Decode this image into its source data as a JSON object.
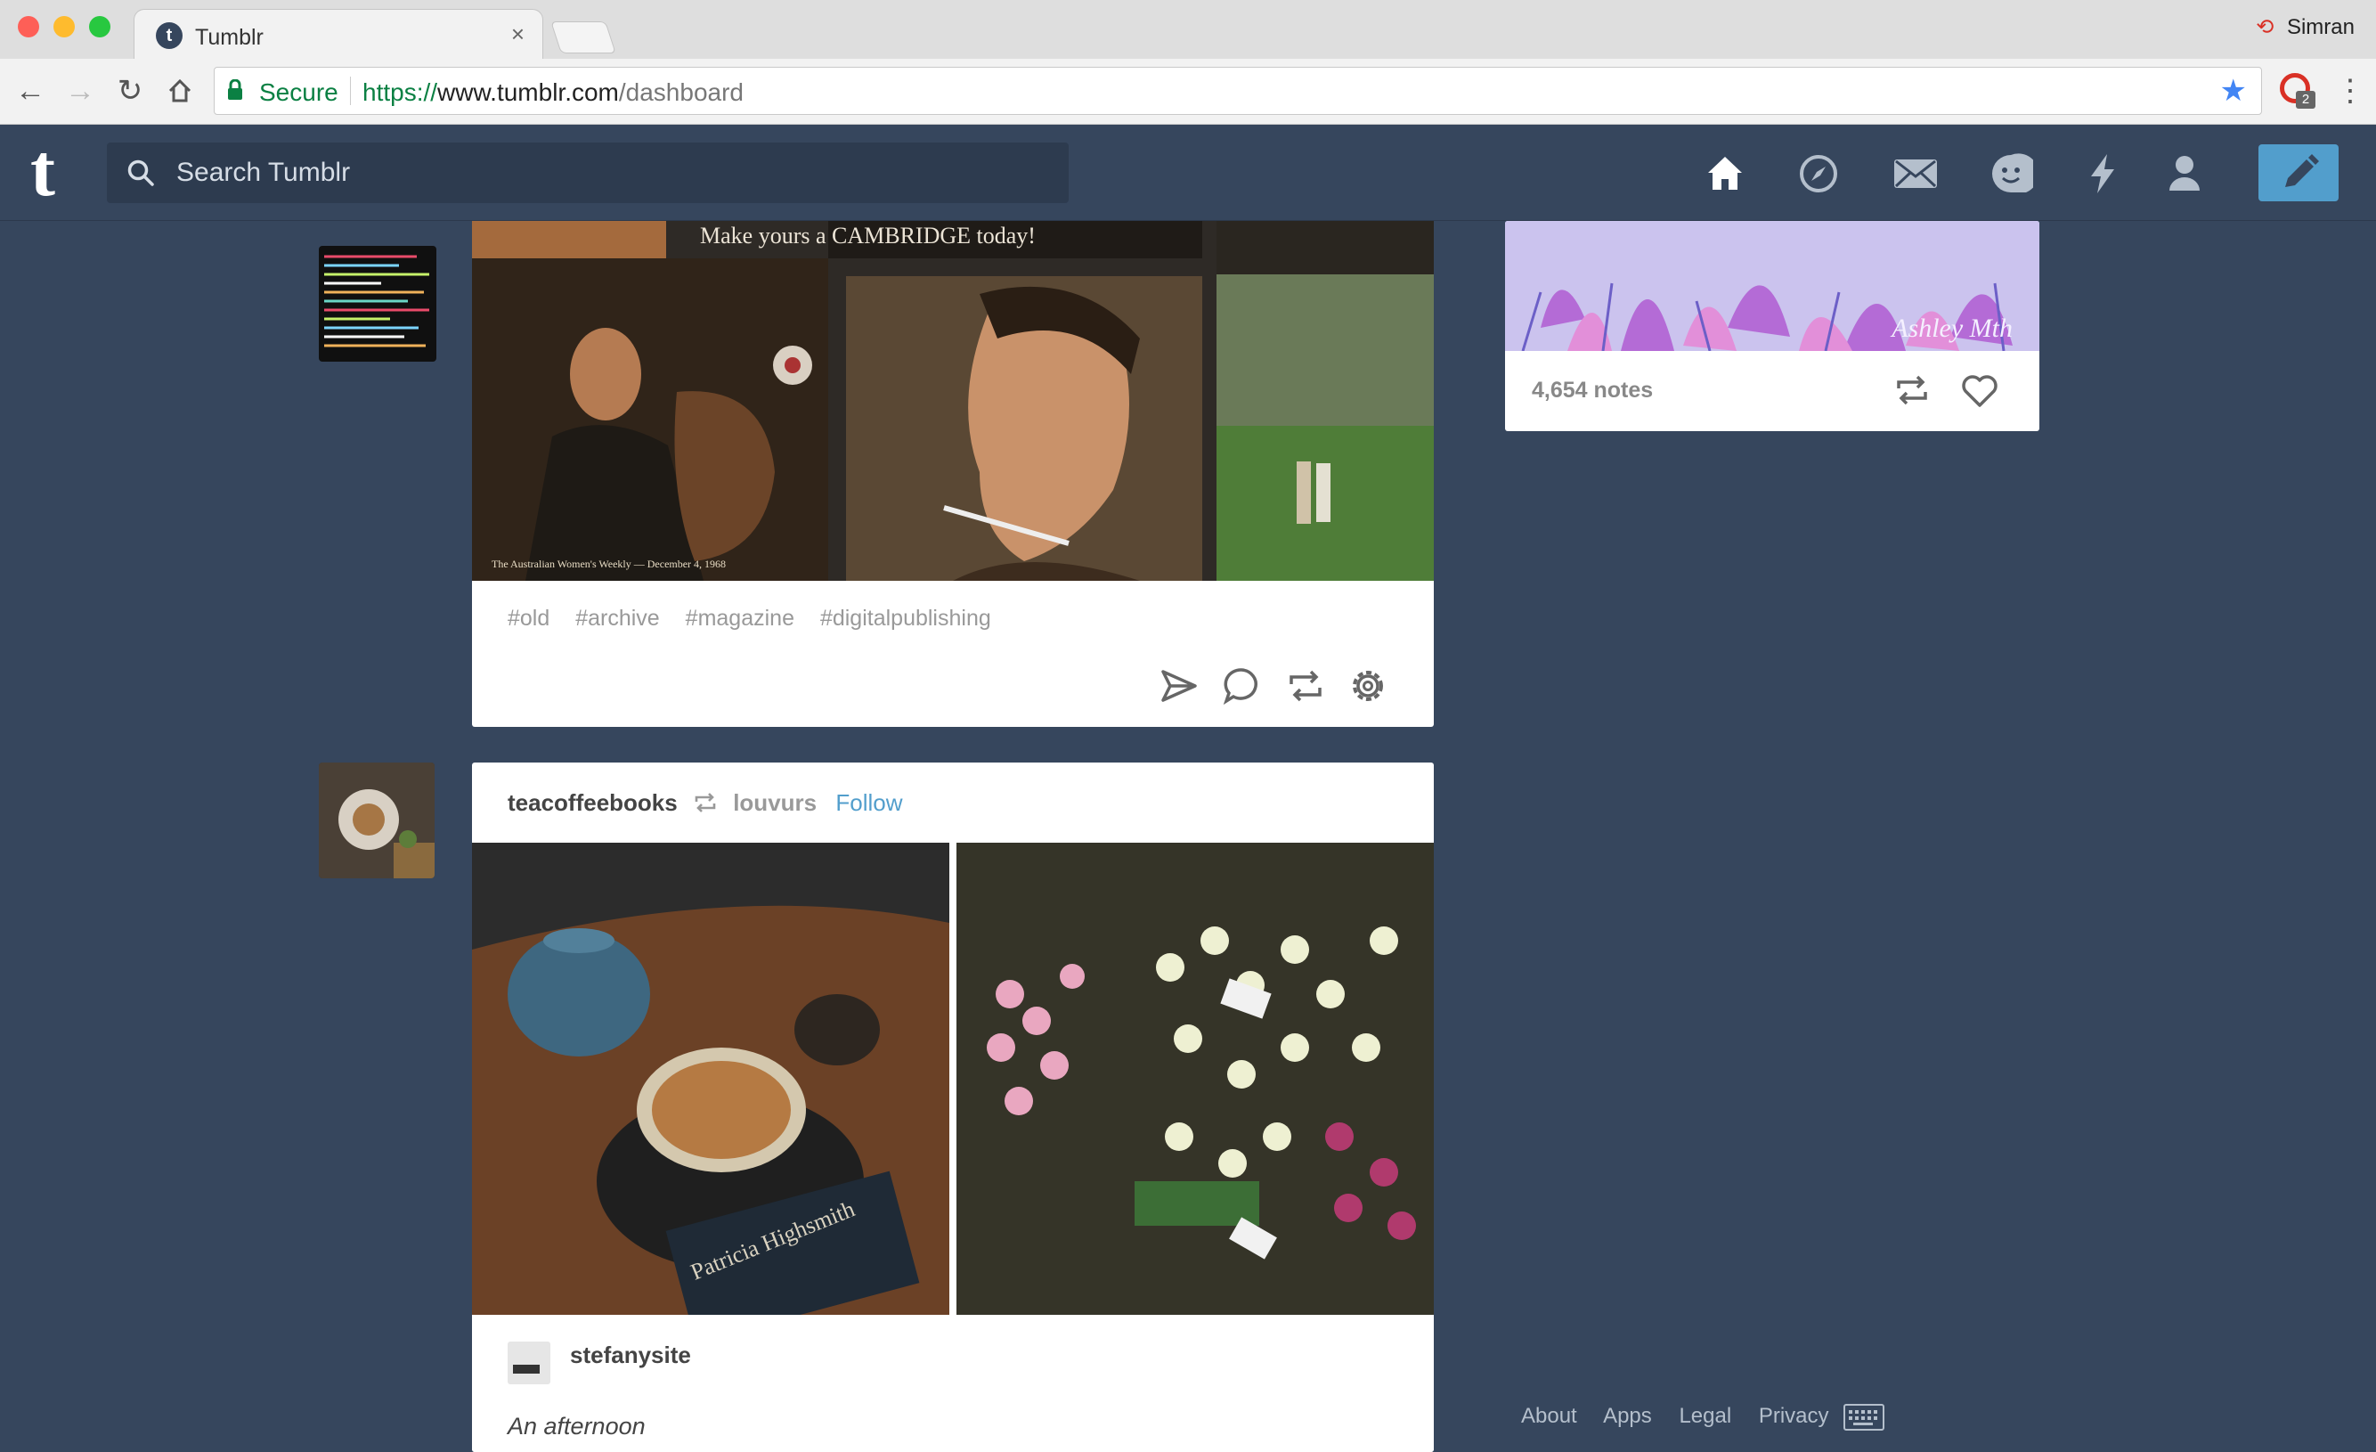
{
  "browser": {
    "tab_title": "Tumblr",
    "tab_favicon": "t",
    "tab_close": "×",
    "profile_name": "Simran",
    "secure_label": "Secure",
    "url_scheme": "https://",
    "url_host": "www.tumblr.com",
    "url_path": "/dashboard",
    "extension_badge": "2"
  },
  "header": {
    "logo": "t",
    "search_placeholder": "Search Tumblr",
    "icons": [
      "home-icon",
      "explore-icon",
      "inbox-icon",
      "messaging-icon",
      "activity-icon",
      "account-icon",
      "compose-icon"
    ]
  },
  "post1": {
    "image_caption": "Make yours a CAMBRIDGE today!",
    "image_footer": "The Australian Women's Weekly — December 4, 1968",
    "tags": [
      "#old",
      "#archive",
      "#magazine",
      "#digitalpublishing"
    ]
  },
  "post2": {
    "user": "teacoffeebooks",
    "reblogged_from": "louvurs",
    "follow_label": "Follow",
    "book_text": "Patricia Highsmith",
    "caption_user": "stefanysite",
    "caption_text": "An afternoon"
  },
  "sidebar_card": {
    "notes": "4,654 notes",
    "signature": "Ashley Mth"
  },
  "footer": {
    "links": [
      "About",
      "Apps",
      "Legal",
      "Privacy"
    ]
  },
  "colors": {
    "tumblr_blue": "#36465d",
    "accent": "#529ecc"
  }
}
